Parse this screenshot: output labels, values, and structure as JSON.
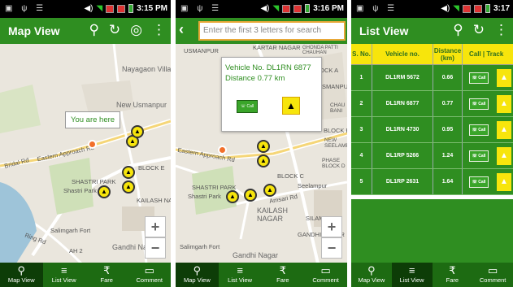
{
  "status": {
    "time1": "3:15 PM",
    "time2": "3:16 PM",
    "time3": "3:17"
  },
  "nav": {
    "map_view": "Map View",
    "list_view": "List View",
    "fare": "Fare",
    "comment": "Comment"
  },
  "screen1": {
    "title": "Map View",
    "you_are_here": "You are here",
    "labels": [
      "Nayagaon Villaj",
      "New Usmanpur",
      "Eastern Approach Rd",
      "Bridal Rd",
      "SHASTRI PARK",
      "Shastri Park",
      "BLOCK E",
      "KAILASH NAGAR",
      "Salimgarh Fort",
      "Gandhi Nagar",
      "Ring Rd",
      "AH 2"
    ]
  },
  "screen2": {
    "search_placeholder": "Enter the first 3 letters for search",
    "popup_line1": "Vehicle No. DL1RN 6877",
    "popup_line2": "Distance 0.77 km",
    "call_label": "Call",
    "labels": [
      "USMANPUR",
      "KARTAR NAGAR",
      "GHONDA PATTI CHAUHAN",
      "BLOCK A",
      "NEW USMANPUR",
      "CHAU BANI",
      "BLOCK B",
      "NEW SEELAMPUR",
      "PHASE BLOCK D",
      "Eastern Approach Rd",
      "SHASTRI PARK",
      "Shastri Park",
      "Amsari Rd",
      "BLOCK C",
      "Seelampur",
      "KAILASH NAGAR",
      "SILAMPUR",
      "GANDHI NAGAR",
      "Salimgarh Fort",
      "Gandhi Nagar"
    ]
  },
  "screen3": {
    "title": "List View",
    "headers": [
      "S. No.",
      "Vehicle no.",
      "Distance (km)",
      "Call | Track"
    ],
    "rows": [
      {
        "sno": "1",
        "vehicle": "DL1RM 5672",
        "distance": "0.66"
      },
      {
        "sno": "2",
        "vehicle": "DL1RN 6877",
        "distance": "0.77"
      },
      {
        "sno": "3",
        "vehicle": "DL1RN 4730",
        "distance": "0.95"
      },
      {
        "sno": "4",
        "vehicle": "DL1RP 5266",
        "distance": "1.24"
      },
      {
        "sno": "5",
        "vehicle": "DL1RP 2631",
        "distance": "1.64"
      }
    ],
    "call_label": "Call"
  },
  "colors": {
    "brand_green": "#2f8e21",
    "nav_green": "#1d6b12",
    "accent_yellow": "#f7e50c"
  }
}
